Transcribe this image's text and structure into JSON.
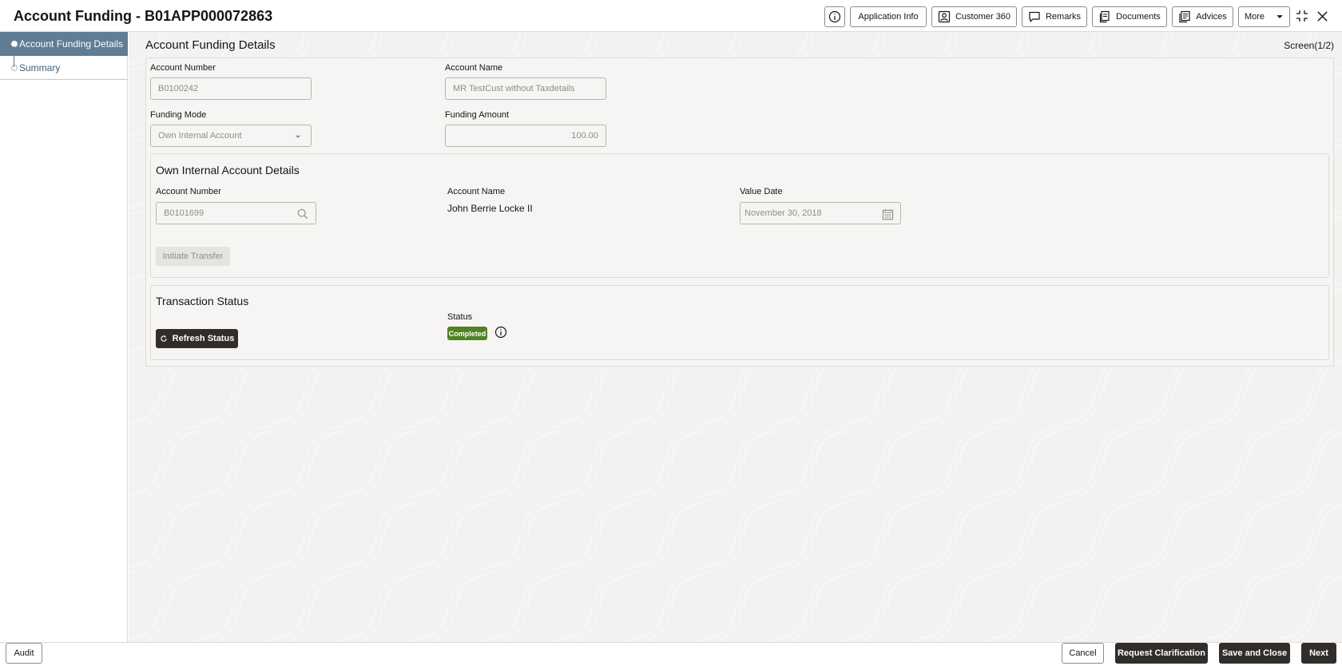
{
  "header": {
    "title": "Account Funding - B01APP000072863",
    "buttons": {
      "application_info": "Application Info",
      "customer_360": "Customer 360",
      "remarks": "Remarks",
      "documents": "Documents",
      "advices": "Advices",
      "more": "More"
    },
    "icons": [
      "info-icon",
      "customer-icon",
      "comment-icon",
      "documents-icon",
      "advices-icon",
      "caret-down-icon",
      "minimize-icon",
      "close-icon"
    ]
  },
  "sidebar": {
    "items": [
      {
        "label": "Account Funding Details",
        "active": true
      },
      {
        "label": "Summary",
        "active": false
      }
    ]
  },
  "main": {
    "section_title": "Account Funding Details",
    "screen_count": "Screen(1/2)",
    "account_number_label": "Account Number",
    "account_number_value": "B0100242",
    "account_name_label": "Account Name",
    "account_name_value": "MR TestCust without Taxdetails",
    "funding_mode_label": "Funding Mode",
    "funding_mode_value": "Own Internal Account",
    "funding_amount_label": "Funding Amount",
    "funding_amount_value": "100.00",
    "own_account": {
      "title": "Own Internal Account Details",
      "account_number_label": "Account Number",
      "account_number_value": "B0101699",
      "account_name_label": "Account Name",
      "account_name_value": "John Berrie Locke II",
      "value_date_label": "Value Date",
      "value_date_value": "November 30, 2018",
      "initiate_transfer_label": "Initiate Transfer"
    },
    "transaction_status": {
      "title": "Transaction Status",
      "refresh_label": "Refresh Status",
      "status_label": "Status",
      "status_value": "Completed",
      "status_color": "#508223"
    }
  },
  "footer": {
    "audit": "Audit",
    "cancel": "Cancel",
    "request_clarification": "Request Clarification",
    "save_and_close": "Save and Close",
    "next": "Next"
  },
  "colors": {
    "primary_dark": "#312d2a",
    "sidebar_active": "#5f7d95",
    "link": "#3d5f7c"
  }
}
